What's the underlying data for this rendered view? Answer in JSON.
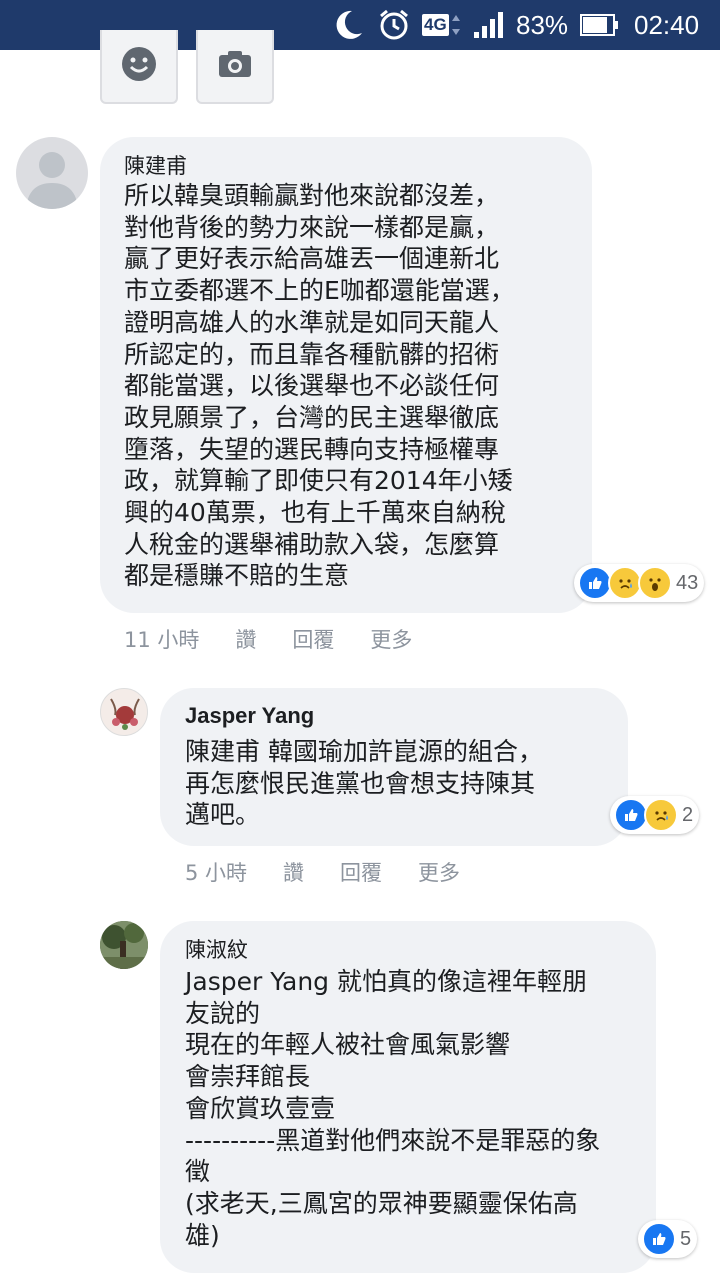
{
  "status_bar": {
    "network": "4G",
    "battery": "83%",
    "time": "02:40"
  },
  "composer": {
    "buttons": [
      "emoji-icon",
      "camera-icon"
    ]
  },
  "comments": [
    {
      "author": "陳建甫",
      "lines": [
        "所以韓臭頭輸贏對他來說都沒差，",
        "對他背後的勢力來說一樣都是贏，",
        "贏了更好表示給高雄丟一個連新北",
        "市立委都選不上的E咖都還能當選，",
        "證明高雄人的水準就是如同天龍人",
        "所認定的，而且靠各種骯髒的招術",
        "都能當選，以後選舉也不必談任何",
        "政見願景了，台灣的民主選舉徹底",
        "墮落，失望的選民轉向支持極權專",
        "政，就算輸了即使只有2014年小矮",
        "興的40萬票，也有上千萬來自納稅",
        "人稅金的選舉補助款入袋，怎麼算",
        "都是穩賺不賠的生意"
      ],
      "reactions": {
        "icons": [
          "like",
          "sad",
          "wow"
        ],
        "count": "43"
      },
      "time": "11 小時",
      "like_label": "讚",
      "reply_label": "回覆",
      "more_label": "更多"
    },
    {
      "author": "Jasper Yang",
      "lines": [
        "陳建甫 韓國瑜加許崑源的組合，",
        "再怎麼恨民進黨也會想支持陳其",
        "邁吧。"
      ],
      "reactions": {
        "icons": [
          "like",
          "sad"
        ],
        "count": "2"
      },
      "time": "5 小時",
      "like_label": "讚",
      "reply_label": "回覆",
      "more_label": "更多"
    },
    {
      "author": "陳淑紋",
      "lines": [
        "Jasper Yang 就怕真的像這裡年輕朋",
        "友說的",
        "現在的年輕人被社會風氣影響",
        "會崇拜館長",
        "會欣賞玖壹壹",
        "----------黑道對他們來說不是罪惡的象",
        "徵",
        "(求老天,三鳳宮的眾神要顯靈保佑高",
        "雄)"
      ],
      "reactions": {
        "icons": [
          "like"
        ],
        "count": "5"
      }
    }
  ],
  "colors": {
    "status_bar": "#1f3a6b",
    "bubble": "#f0f2f5",
    "meta_text": "#8d949e",
    "like_blue": "#1877f2"
  }
}
